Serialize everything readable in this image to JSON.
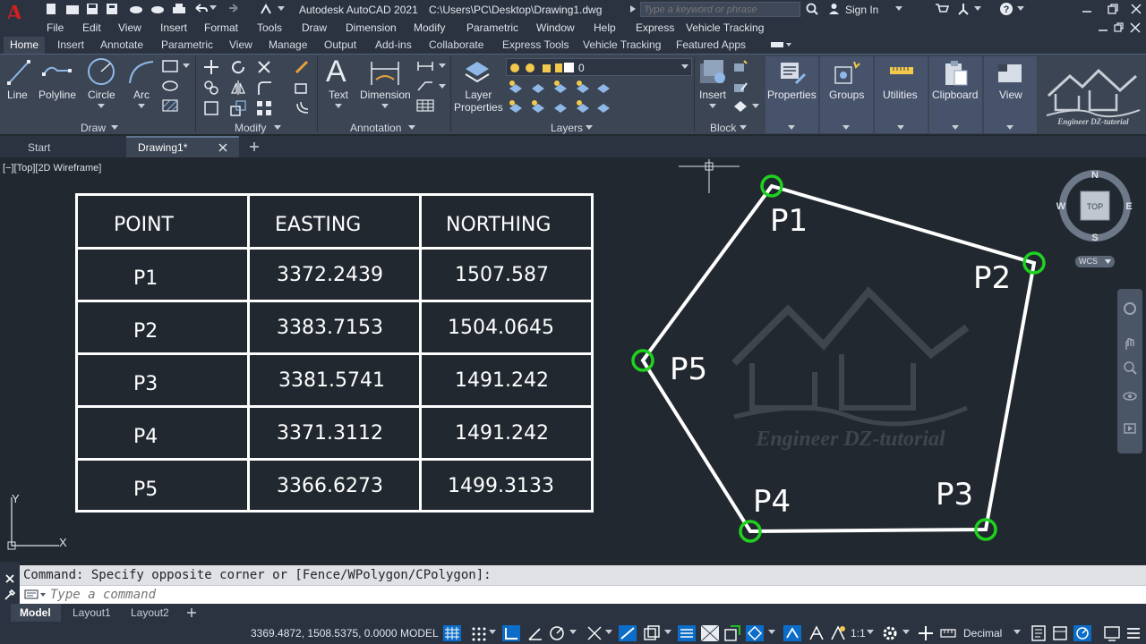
{
  "titlebar": {
    "app_title": "Autodesk AutoCAD 2021",
    "file_path": "C:\\Users\\PC\\Desktop\\Drawing1.dwg",
    "search_placeholder": "Type a keyword or phrase",
    "sign_in": "Sign In"
  },
  "menu": [
    "File",
    "Edit",
    "View",
    "Insert",
    "Format",
    "Tools",
    "Draw",
    "Dimension",
    "Modify",
    "Parametric",
    "Window",
    "Help",
    "Express",
    "Vehicle Tracking"
  ],
  "ribbon_tabs": [
    "Home",
    "Insert",
    "Annotate",
    "Parametric",
    "View",
    "Manage",
    "Output",
    "Add-ins",
    "Collaborate",
    "Express Tools",
    "Vehicle Tracking",
    "Featured Apps"
  ],
  "ribbon": {
    "draw_tools": [
      "Line",
      "Polyline",
      "Circle",
      "Arc"
    ],
    "panels": {
      "draw": "Draw",
      "modify": "Modify",
      "annotation": "Annotation",
      "layers": "Layers",
      "block": "Block"
    },
    "annotation_tools": [
      "Text",
      "Dimension"
    ],
    "layer_properties_line1": "Layer",
    "layer_properties_line2": "Properties",
    "layer_current": "0",
    "insert_label": "Insert",
    "big_buttons": [
      "Properties",
      "Groups",
      "Utilities",
      "Clipboard",
      "View"
    ]
  },
  "file_tabs": [
    "Start",
    "Drawing1*"
  ],
  "viewport_label": "[−][Top][2D Wireframe]",
  "viewcube": {
    "n": "N",
    "s": "S",
    "e": "E",
    "w": "W",
    "face": "TOP",
    "wcs": "WCS"
  },
  "table": {
    "headers": [
      "POINT",
      "EASTING",
      "NORTHING"
    ],
    "rows": [
      [
        "P1",
        "3372.2439",
        "1507.587"
      ],
      [
        "P2",
        "3383.7153",
        "1504.0645"
      ],
      [
        "P3",
        "3381.5741",
        "1491.242"
      ],
      [
        "P4",
        "3371.3112",
        "1491.242"
      ],
      [
        "P5",
        "3366.6273",
        "1499.3133"
      ]
    ]
  },
  "polygon_labels": [
    "P1",
    "P2",
    "P3",
    "P4",
    "P5"
  ],
  "ucs": {
    "x": "X",
    "y": "Y"
  },
  "watermark": {
    "brand": "Engineer DZ-tutorial"
  },
  "command": {
    "history": "Command: Specify opposite corner or [Fence/WPolygon/CPolygon]:",
    "placeholder": "Type a command"
  },
  "layout_tabs": [
    "Model",
    "Layout1",
    "Layout2"
  ],
  "status": {
    "coords": "3369.4872, 1508.5375, 0.0000",
    "space": "MODEL",
    "scale": "1:1",
    "units": "Decimal"
  },
  "colors": {
    "accent": "#0b6dc7",
    "highlight": "#1fd21f",
    "autocad_red": "#d21f1f"
  }
}
